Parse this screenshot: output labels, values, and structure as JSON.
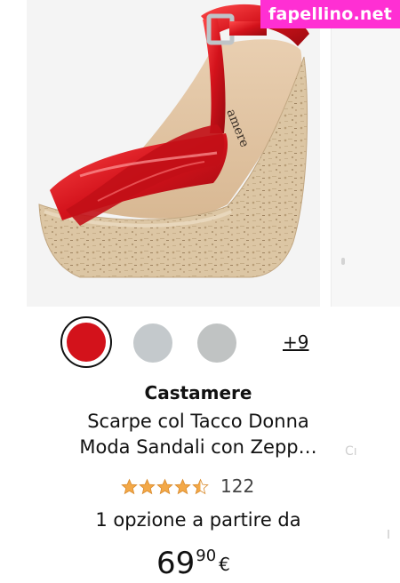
{
  "watermark": "fapellino.net",
  "product": {
    "image_alt": "Red patent wedge sandal with cork platform",
    "insole_text": "amere",
    "swatches": [
      {
        "name": "red",
        "color": "#d3121b",
        "selected": true
      },
      {
        "name": "light-grey",
        "color": "#c4c9cc",
        "selected": false
      },
      {
        "name": "grey",
        "color": "#c0c3c3",
        "selected": false
      }
    ],
    "more_colors": "+9",
    "brand": "Castamere",
    "title_line1": "Scarpe col Tacco Donna",
    "title_line2": "Moda Sandali con Zepp…",
    "rating_value": 4.5,
    "rating_count": "122",
    "options_text": "1 opzione a partire da",
    "price_whole": "69",
    "price_fraction": "90",
    "price_currency": "€"
  },
  "next_card": {
    "partial_text": "Cı"
  },
  "colors": {
    "accent_star": "#f3a847",
    "watermark_bg": "#ff2fd3",
    "cork": "#d9c29f",
    "patent_red": "#d3121b"
  }
}
